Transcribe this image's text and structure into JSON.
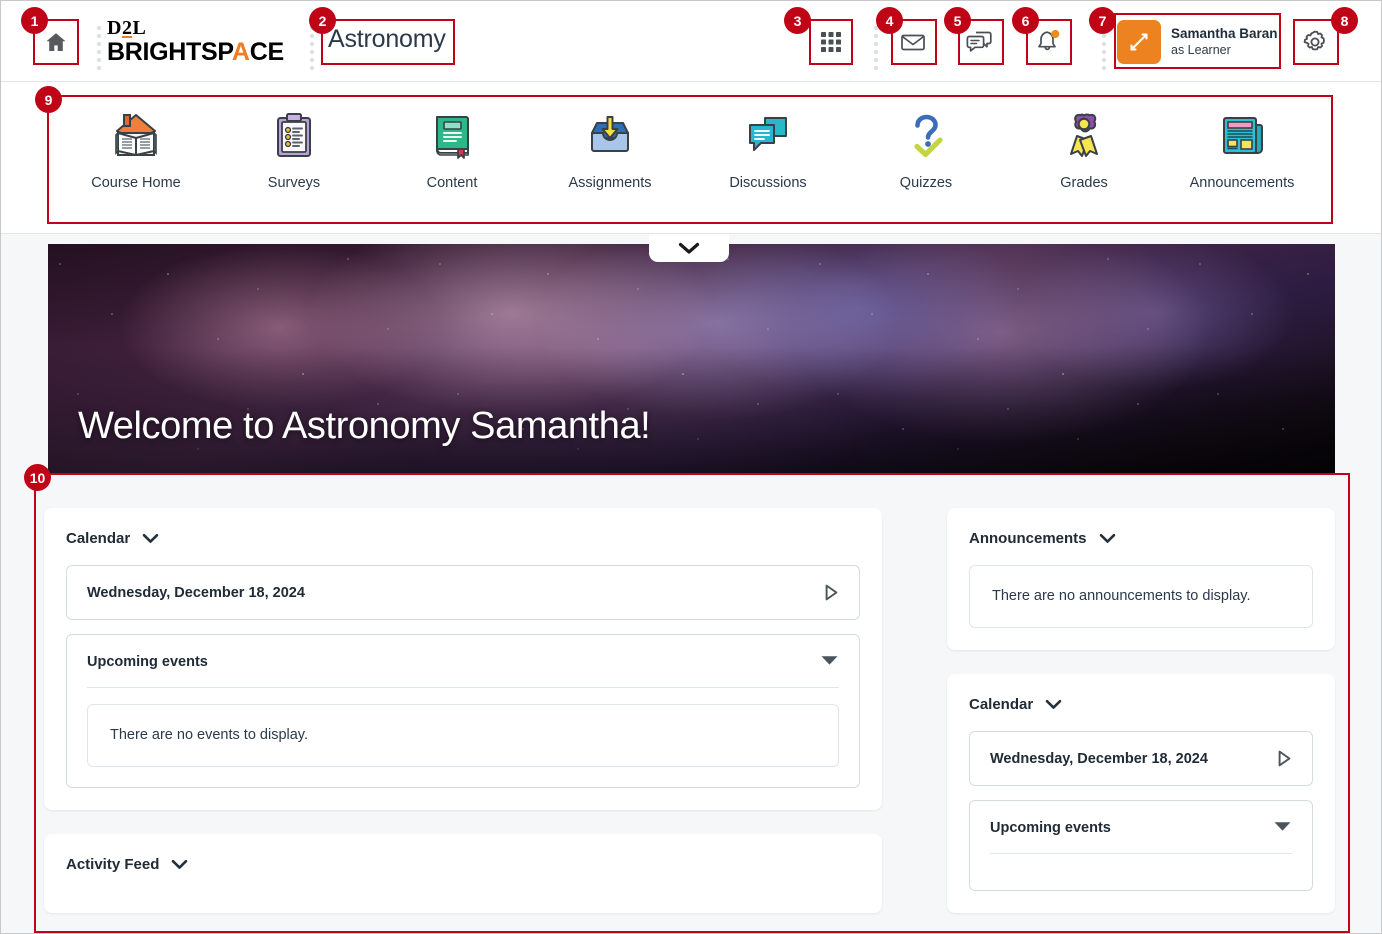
{
  "header": {
    "home_icon": "home-icon",
    "brand_primary": "D2L",
    "brand_secondary": "BRIGHTSPACE",
    "course_title": "Astronomy",
    "waffle_icon": "grid-apps-icon",
    "message_icon": "envelope-icon",
    "subscription_icon": "chat-bubbles-icon",
    "notification_icon": "bell-icon",
    "settings_icon": "gear-icon",
    "role": {
      "switch_icon": "role-switch-arrows-icon",
      "user_name": "Samantha Baran",
      "role_label": "as Learner",
      "swatch_color": "#ec8320"
    }
  },
  "navbar": {
    "items": [
      {
        "label": "Course Home",
        "icon": "house-open-book-icon"
      },
      {
        "label": "Surveys",
        "icon": "clipboard-checklist-icon"
      },
      {
        "label": "Content",
        "icon": "green-book-icon"
      },
      {
        "label": "Assignments",
        "icon": "inbox-down-arrow-icon"
      },
      {
        "label": "Discussions",
        "icon": "speech-bubbles-icon"
      },
      {
        "label": "Quizzes",
        "icon": "question-mark-check-icon"
      },
      {
        "label": "Grades",
        "icon": "award-ribbon-icon"
      },
      {
        "label": "Announcements",
        "icon": "newspaper-icon"
      }
    ]
  },
  "hero": {
    "title": "Welcome to Astronomy Samantha!",
    "collapse_icon": "chevron-down-icon"
  },
  "widgets": {
    "left": [
      {
        "title": "Calendar",
        "chevron_icon": "chevron-down-icon",
        "date_label": "Wednesday, December 18, 2024",
        "date_nav_icon": "play-triangle-right-icon",
        "events_label": "Upcoming events",
        "events_toggle_icon": "triangle-down-icon",
        "empty_text": "There are no events to display."
      },
      {
        "title": "Activity Feed",
        "chevron_icon": "chevron-down-icon"
      }
    ],
    "right": [
      {
        "title": "Announcements",
        "chevron_icon": "chevron-down-icon",
        "empty_text": "There are no announcements to display."
      },
      {
        "title": "Calendar",
        "chevron_icon": "chevron-down-icon",
        "date_label": "Wednesday, December 18, 2024",
        "date_nav_icon": "play-triangle-right-icon",
        "events_label": "Upcoming events",
        "events_toggle_icon": "triangle-down-icon"
      }
    ]
  },
  "annotations": {
    "accent_color": "#c00418",
    "markers": [
      "1",
      "2",
      "3",
      "4",
      "5",
      "6",
      "7",
      "8",
      "9",
      "10"
    ]
  }
}
